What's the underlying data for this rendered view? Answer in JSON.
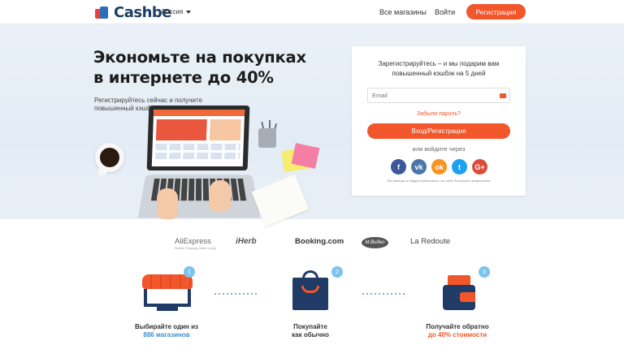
{
  "header": {
    "logo_text": "Cashbe",
    "region": "Россия",
    "nav": [
      {
        "label": "Все магазины"
      },
      {
        "label": "Войти"
      }
    ],
    "register_label": "Регистрация"
  },
  "hero": {
    "title": "Экономьте на покупках в интернете до 40%",
    "subtitle": "Регистрируйтесь сейчас и получите повышенный кэшбэк в подарок"
  },
  "signup": {
    "title": "Зарегистрируйтесь – и мы подарим вам повышенный кэшбэк на 5 дней",
    "email_placeholder": "Email",
    "forgot_label": "Забыли пароль?",
    "submit_label": "Вход/Регистрация",
    "or_label": "или войдите через",
    "socials": [
      {
        "name": "facebook",
        "glyph": "f",
        "color": "#3b5998"
      },
      {
        "name": "vkontakte",
        "glyph": "vk",
        "color": "#4a76a8"
      },
      {
        "name": "odnoklassniki",
        "glyph": "ok",
        "color": "#f7931e"
      },
      {
        "name": "twitter",
        "glyph": "t",
        "color": "#1da1f2"
      },
      {
        "name": "google-plus",
        "glyph": "G+",
        "color": "#dd4b39"
      }
    ],
    "disclaimer": "Мы никогда не будем публиковать что-либо без вашего разрешения"
  },
  "brands": [
    {
      "name": "AliExpress",
      "tagline": "Smarter Shopping, Better Living!"
    },
    {
      "name": "iHerb"
    },
    {
      "name": "Booking.com"
    },
    {
      "name": "M.Видео"
    },
    {
      "name": "La Redoute"
    }
  ],
  "steps": [
    {
      "number": "1",
      "line1": "Выбирайте один из",
      "line2": "886 магазинов"
    },
    {
      "number": "2",
      "line1": "Покупайте",
      "line2": "как обычно"
    },
    {
      "number": "3",
      "line1": "Получайте обратно",
      "line2": "до 40% стоимости"
    }
  ]
}
